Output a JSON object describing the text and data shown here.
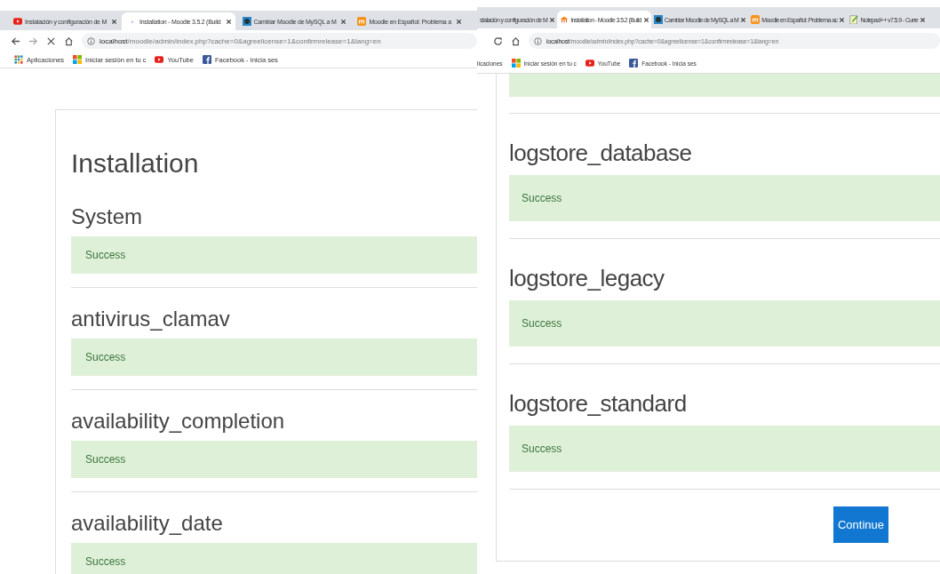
{
  "windows": [
    {
      "tabs": [
        {
          "title": "Instalación y configuración de M",
          "kind": "youtube",
          "selected": false
        },
        {
          "title": "Installation - Moodle 3.5.2 (Build",
          "kind": "dot",
          "selected": true
        },
        {
          "title": "Cambiar Moodle de MySQL a M",
          "kind": "site",
          "selected": false
        },
        {
          "title": "Moodle en Español: Problema a",
          "kind": "moodle",
          "selected": false
        }
      ],
      "loading": true,
      "url_host": "localhost",
      "url_path": "/moodle/admin/index.php?cache=0&agreelicense=1&confirmrelease=1&lang=en",
      "bookmarks": [
        {
          "label": "Aplicaciones",
          "kind": "apps"
        },
        {
          "label": "Iniciar sesión en tu c",
          "kind": "windows"
        },
        {
          "label": "YouTube",
          "kind": "youtube"
        },
        {
          "label": "Facebook - Inicia ses",
          "kind": "facebook"
        }
      ],
      "page": {
        "title": "Installation",
        "sections": [
          {
            "heading": "System",
            "message": "Success"
          },
          {
            "heading": "antivirus_clamav",
            "message": "Success"
          },
          {
            "heading": "availability_completion",
            "message": "Success"
          },
          {
            "heading": "availability_date",
            "message": "Success"
          }
        ]
      }
    },
    {
      "tabs": [
        {
          "title": "stalación y configuración de M",
          "kind": "cut",
          "selected": false
        },
        {
          "title": "Installation - Moodle 3.5.2 (Build",
          "kind": "hat",
          "selected": true
        },
        {
          "title": "Cambiar Moodle de MySQL a M",
          "kind": "site",
          "selected": false
        },
        {
          "title": "Moodle en Español: Problema ac",
          "kind": "moodle",
          "selected": false
        },
        {
          "title": "Notepad++ v7.5.9 - Curre",
          "kind": "notepad",
          "selected": false
        }
      ],
      "loading": false,
      "url_host": "localhost",
      "url_path": "/moodle/admin/index.php?cache=0&agreelicense=1&confirmrelease=1&lang=en",
      "bookmarks": [
        {
          "label": "licaciones",
          "kind": "cut"
        },
        {
          "label": "Iniciar sesión en tu c",
          "kind": "windows"
        },
        {
          "label": "YouTube",
          "kind": "youtube"
        },
        {
          "label": "Facebook - Inicia ses",
          "kind": "facebook"
        }
      ],
      "page": {
        "leading_alert": true,
        "sections": [
          {
            "heading": "logstore_database",
            "message": "Success"
          },
          {
            "heading": "logstore_legacy",
            "message": "Success"
          },
          {
            "heading": "logstore_standard",
            "message": "Success"
          }
        ],
        "button": "Continue"
      }
    }
  ]
}
